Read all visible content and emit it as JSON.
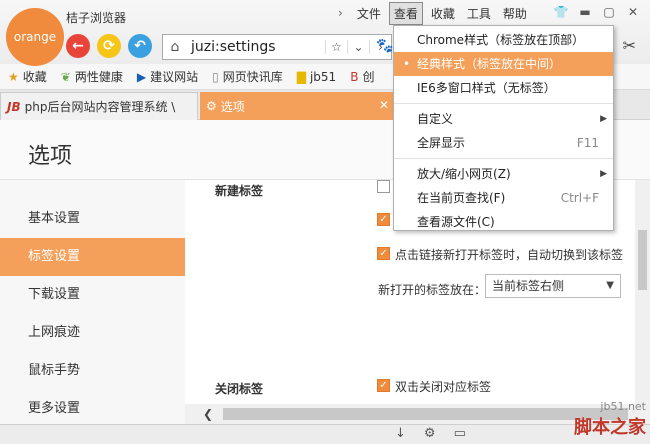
{
  "app": {
    "logo_text": "orange",
    "title": "桔子浏览器"
  },
  "menu": {
    "back_arrow": "›",
    "items": [
      "文件",
      "查看",
      "收藏",
      "工具",
      "帮助"
    ],
    "active": "查看"
  },
  "address": {
    "url": "juzi:settings"
  },
  "bookmarks": [
    "收藏",
    "两性健康",
    "建议网站",
    "网页快讯库",
    "jb51",
    "创"
  ],
  "tabs": [
    {
      "label": "php后台网站内容管理系统 \\",
      "fav": "JB"
    },
    {
      "label": "选项",
      "fav": "⚙"
    }
  ],
  "page": {
    "title": "选项",
    "sidebar": [
      "基本设置",
      "标签设置",
      "下载设置",
      "上网痕迹",
      "鼠标手势",
      "更多设置"
    ],
    "active_item": "标签设置",
    "sections": {
      "new_tab_label": "新建标签",
      "option_link_switch": "点击链接新打开标签时，自动切换到该标签",
      "open_at_label": "新打开的标签放在：",
      "open_at_value": "当前标签右侧",
      "close_tab_label": "关闭标签",
      "option_dblclick_close": "双击关闭对应标签"
    }
  },
  "dropdown": {
    "items": [
      {
        "label": "Chrome样式（标签放在顶部）"
      },
      {
        "label": "经典样式（标签放在中间）",
        "selected": true
      },
      {
        "label": "IE6多窗口样式（无标签）"
      },
      {
        "label": "自定义",
        "submenu": true
      },
      {
        "label": "全屏显示",
        "shortcut": "F11"
      },
      {
        "label": "放大/缩小网页(Z)",
        "submenu": true
      },
      {
        "label": "在当前页查找(F)",
        "shortcut": "Ctrl+F"
      },
      {
        "label": "查看源文件(C)"
      }
    ]
  },
  "watermark": {
    "site": "jb51.net",
    "brand": "脚本之家"
  },
  "colors": {
    "accent": "#f5a05a",
    "logo": "#f08a3c",
    "back_btn": "#e8443a",
    "refresh_btn": "#f5c518",
    "home_btn": "#3aa0e0"
  }
}
